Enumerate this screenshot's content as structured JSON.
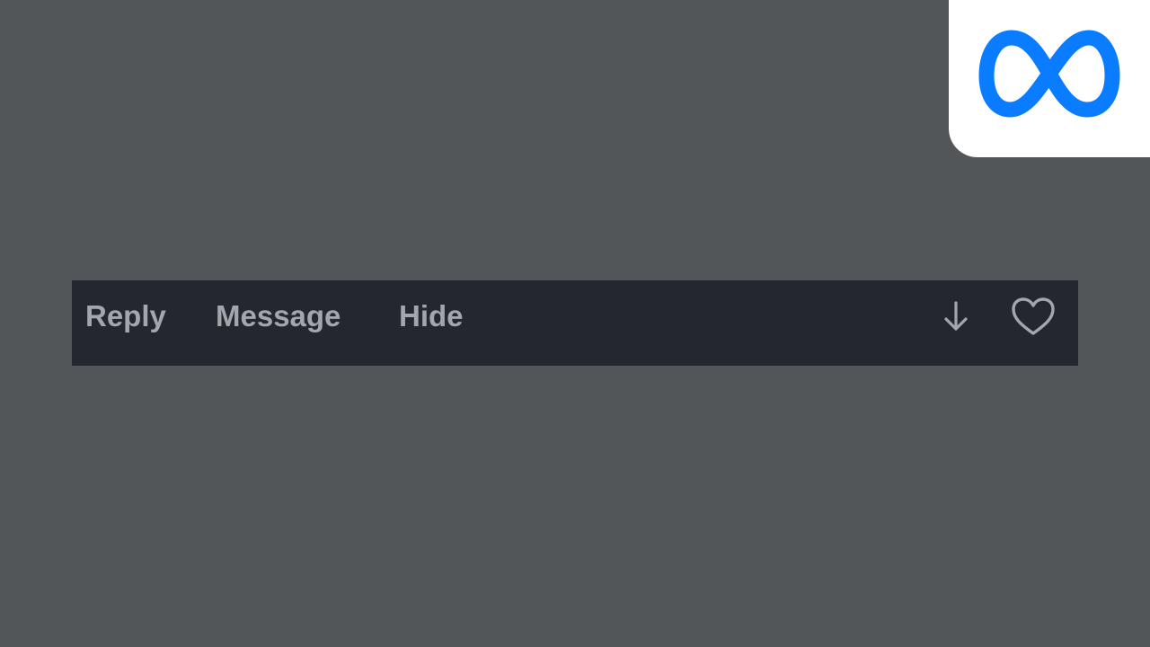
{
  "actions": {
    "reply_label": "Reply",
    "message_label": "Message",
    "hide_label": "Hide"
  },
  "icons": {
    "download": "arrow-down-icon",
    "like": "heart-outline-icon",
    "brand": "meta-infinity-logo"
  },
  "colors": {
    "page_background": "#535659",
    "bar_background": "#24282e",
    "label_text": "#a3a7ad",
    "brand_blue": "#0a7cff",
    "brand_card": "#ffffff"
  }
}
